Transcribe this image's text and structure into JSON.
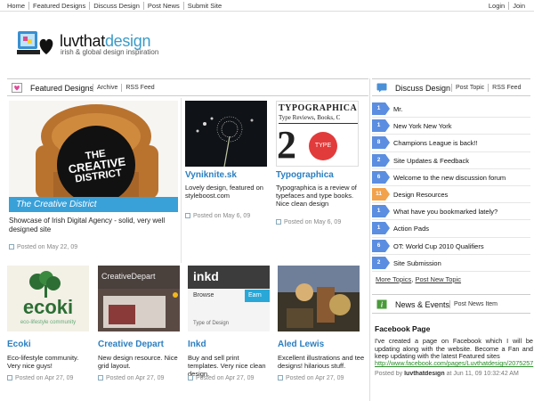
{
  "topnav": {
    "left": [
      "Home",
      "Featured Designs",
      "Discuss Design",
      "Post News",
      "Submit Site"
    ],
    "right": [
      "Login",
      "Join"
    ]
  },
  "logo": {
    "name_a": "luvthat",
    "name_b": "design",
    "tagline": "irish & global design inspiration"
  },
  "featured": {
    "title": "Featured Designs",
    "links": [
      "Archive",
      "RSS Feed"
    ],
    "hero": {
      "banner": "The Creative District",
      "sign_lines": [
        "THE",
        "CREATIVE",
        "DISTRICT"
      ],
      "desc": "Showcase of Irish Digital Agency - solid, very well designed site",
      "meta": "Posted on May 22, 09"
    },
    "cards": [
      {
        "title": "Vyniknite.sk",
        "desc": "Lovely design, featured on styleboost.com",
        "meta": "Posted on May 6, 09"
      },
      {
        "title": "Typographica",
        "desc": "Typographica is a review of typefaces and type books. Nice clean design",
        "meta": "Posted on May 6, 09",
        "thumb_title": "TYPOGRAPHICA",
        "thumb_sub": "Type Reviews, Books, C",
        "thumb_badge": "TYPE"
      },
      {
        "title": "Ecoki",
        "desc": "Eco-lifestyle community. Very nice guys!",
        "meta": "Posted on Apr 27, 09",
        "thumb_logo": "ecoki",
        "thumb_sub": "eco-lifestyle community"
      },
      {
        "title": "Creative Depart",
        "desc": "New design resource. Nice grid layout.",
        "meta": "Posted on Apr 27, 09",
        "thumb_logo": "CreativeDepart"
      },
      {
        "title": "Inkd",
        "desc": "Buy and sell print templates. Very nice clean design.",
        "meta": "Posted on Apr 27, 09",
        "thumb_logo": "inkd",
        "thumb_browse": "Browse",
        "thumb_earn": "Earn",
        "thumb_sub": "Type of Design"
      },
      {
        "title": "Aled Lewis",
        "desc": "Excellent illustrations and tee designs! hilarious stuff.",
        "meta": "Posted on Apr 27, 09"
      }
    ]
  },
  "discuss": {
    "title": "Discuss Design",
    "links": [
      "Post Topic",
      "RSS Feed"
    ],
    "items": [
      {
        "count": "1",
        "label": "Mr."
      },
      {
        "count": "1",
        "label": "New York New York"
      },
      {
        "count": "8",
        "label": "Champions League is back!!"
      },
      {
        "count": "2",
        "label": "Site Updates & Feedback"
      },
      {
        "count": "6",
        "label": "Welcome to the new discussion forum"
      },
      {
        "count": "11",
        "label": "Design Resources"
      },
      {
        "count": "1",
        "label": "What have you bookmarked lately?"
      },
      {
        "count": "1",
        "label": "Action Pads"
      },
      {
        "count": "6",
        "label": "OT: World Cup 2010 Qualifiers"
      },
      {
        "count": "2",
        "label": "Site Submission"
      }
    ],
    "more_topics": "More Topics",
    "post_new_topic": "Post New Topic"
  },
  "news": {
    "title": "News & Events",
    "link": "Post News Item",
    "item_title": "Facebook Page",
    "item_body": "I've created a page on Facebook which I will be updating along with the website. Become a Fan and keep updating with the latest Featured sites",
    "item_link": "http://www.facebook.com/pages/Luvthatdesign/2075257",
    "posted_by_prefix": "Posted by",
    "author": "luvthatdesign",
    "posted_at": "at Jun 11, 09 10:32:42 AM"
  },
  "colors": {
    "accent": "#2b7fc0",
    "badge": "#5b8ee0",
    "badge_hot": "#f2a24a"
  }
}
